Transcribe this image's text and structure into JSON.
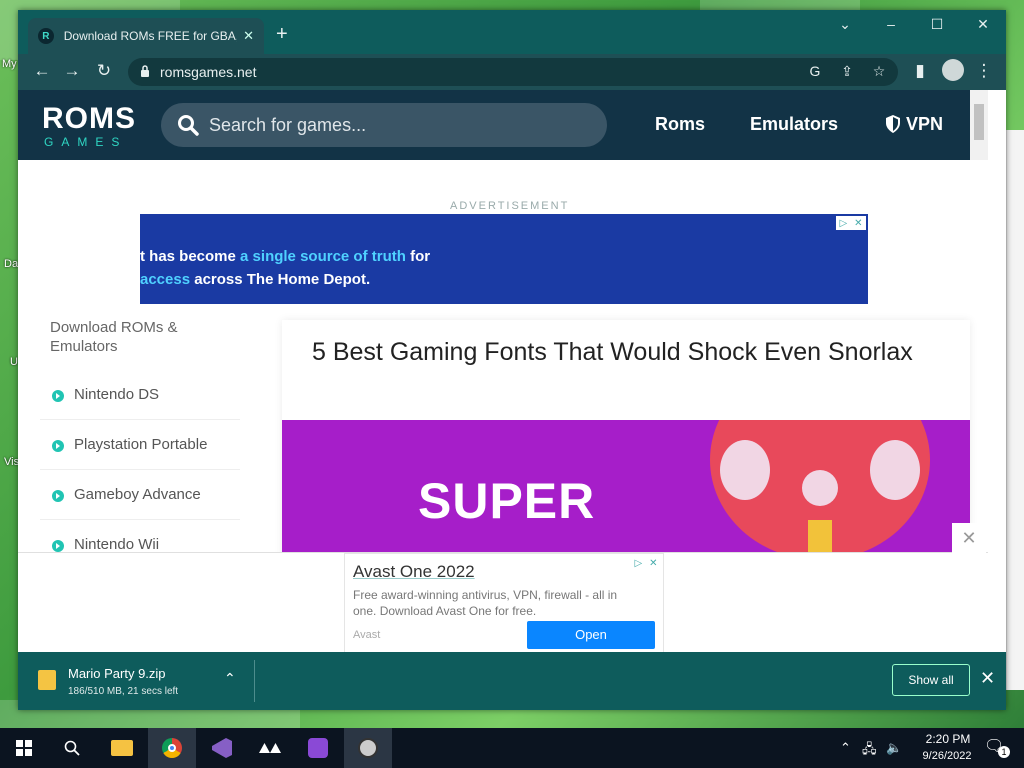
{
  "desktop": {
    "labels": [
      "My",
      "Da",
      "U",
      "Vis"
    ]
  },
  "browser": {
    "tab_title": "Download ROMs FREE for GBA, S",
    "tab_favicon_letter": "R",
    "url": "romsgames.net"
  },
  "site": {
    "logo_top": "ROMS",
    "logo_bottom": "GAMES",
    "search_placeholder": "Search for games...",
    "nav": [
      "Roms",
      "Emulators",
      "VPN"
    ]
  },
  "ad": {
    "label": "ADVERTISEMENT",
    "line1_pre": "t has become ",
    "line1_hl": "a single source of truth",
    "line1_post": " for",
    "line2_hl": "access",
    "line2_post": " across The Home Depot."
  },
  "sidebar": {
    "title": "Download ROMs & Emulators",
    "items": [
      "Nintendo DS",
      "Playstation Portable",
      "Gameboy Advance",
      "Nintendo Wii"
    ]
  },
  "article": {
    "title": "5 Best Gaming Fonts That Would Shock Even Snorlax",
    "image_text": "SUPER"
  },
  "sticky_ad": {
    "title": "Avast One 2022",
    "description": "Free award-winning antivirus, VPN, firewall - all in one. Download Avast One for free.",
    "brand": "Avast",
    "button": "Open"
  },
  "download": {
    "file_name": "Mario Party 9.zip",
    "status": "186/510 MB, 21 secs left",
    "show_all": "Show all"
  },
  "taskbar": {
    "time": "2:20 PM",
    "date": "9/26/2022",
    "notification_count": "1"
  },
  "colors": {
    "titlebar": "#0e5c5c",
    "site_nav": "#123346",
    "accent": "#2fd6c3"
  }
}
